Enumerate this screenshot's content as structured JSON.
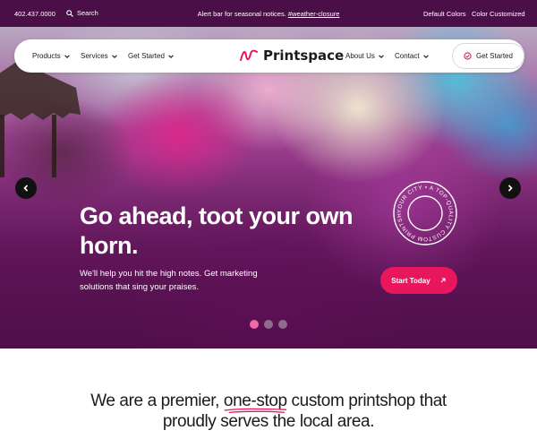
{
  "topbar": {
    "phone": "402.437.0000",
    "search_label": "Search",
    "alert_text": "Alert bar for seasonal notices.",
    "alert_link": "#weather-closure",
    "default_colors": "Default Colors",
    "color_customized": "Color Customized",
    "background": "#4b0f47"
  },
  "nav": {
    "left_items": [
      "Products",
      "Services",
      "Get Started"
    ],
    "logo_text": "Printspace",
    "right_items": [
      "About Us",
      "Contact"
    ],
    "cta_label": "Get Started",
    "logo_color": "#e8175d"
  },
  "hero": {
    "title": "Go ahead, toot your own horn.",
    "subtitle": "We'll help you hit the high notes. Get marketing solutions that sing your praises.",
    "button_label": "Start Today",
    "button_color": "#e8175d",
    "stamp_text": "YOUR CITY • A TOP-QUALITY CUSTOM PRINTSHOP •",
    "slides": {
      "count": 3,
      "active": 1
    }
  },
  "intro": {
    "part1": "We are a premier, ",
    "highlight": "one-stop",
    "part2": " custom printshop that",
    "line2": "proudly serves the local area.",
    "accent": "#e8175d"
  }
}
